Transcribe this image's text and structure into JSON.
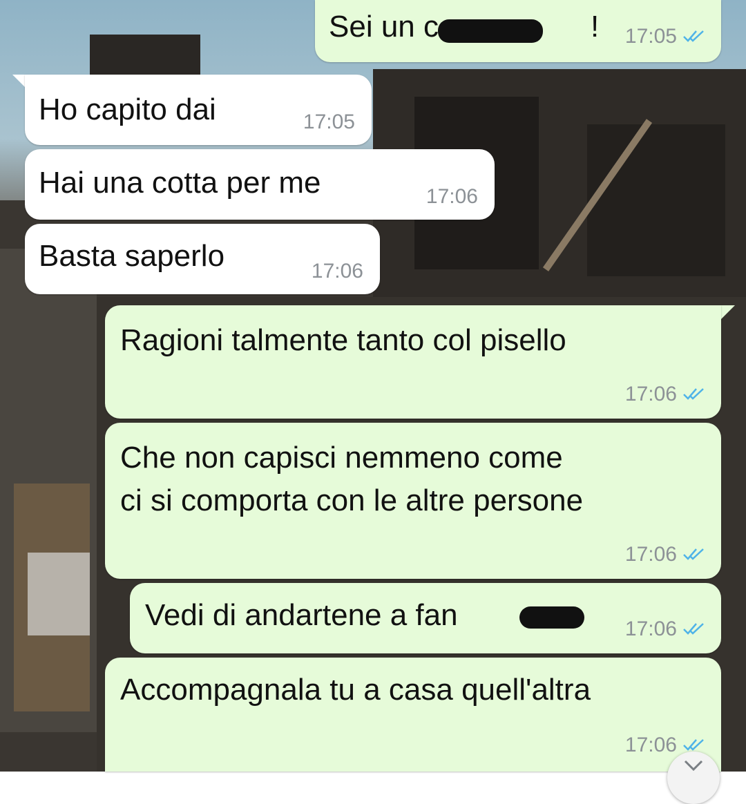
{
  "chat": {
    "messages": [
      {
        "direction": "out",
        "text": "Sei un c     !",
        "time": "17:05",
        "status": "read"
      },
      {
        "direction": "in",
        "text": "Ho capito dai",
        "time": "17:05"
      },
      {
        "direction": "in",
        "text": "Hai una cotta per me",
        "time": "17:06"
      },
      {
        "direction": "in",
        "text": "Basta saperlo",
        "time": "17:06"
      },
      {
        "direction": "out",
        "text": "Ragioni talmente tanto col pisello",
        "time": "17:06",
        "status": "read"
      },
      {
        "direction": "out",
        "text_line1": "Che non capisci nemmeno come",
        "text_line2": "ci si comporta con le altre persone",
        "time": "17:06",
        "status": "read"
      },
      {
        "direction": "out",
        "text": "Vedi di andartene a fan",
        "time": "17:06",
        "status": "read"
      },
      {
        "direction": "out",
        "text": "Accompagnala tu a casa quell'altra",
        "time": "17:06",
        "status": "read"
      }
    ]
  },
  "colors": {
    "incoming_bubble": "#ffffff",
    "outgoing_bubble": "#e6fbd9",
    "read_tick": "#4fb3e8",
    "timestamp": "#8c9196"
  },
  "icons": {
    "read_receipt": "double-check-icon",
    "scroll": "chevron-down-icon"
  }
}
